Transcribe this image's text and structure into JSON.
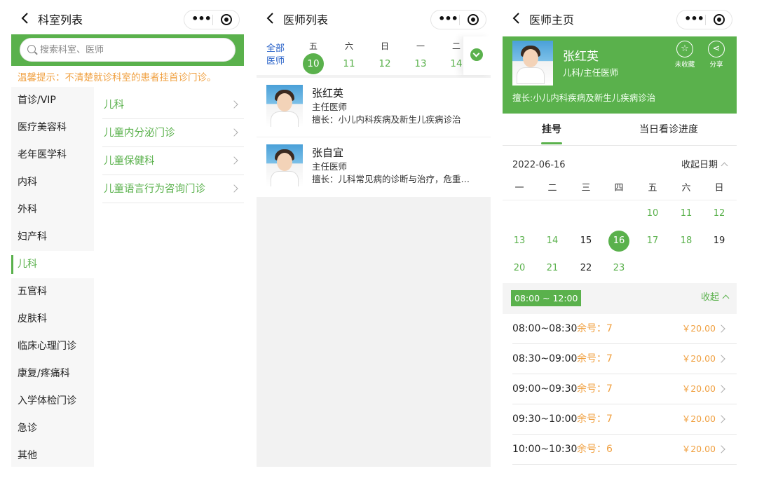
{
  "screen1": {
    "title": "科室列表",
    "search_placeholder": "搜索科室、医师",
    "tip": "温馨提示：不清楚就诊科室的患者挂首诊门诊。",
    "departments": [
      "首诊/VIP",
      "医疗美容科",
      "老年医学科",
      "内科",
      "外科",
      "妇产科",
      "儿科",
      "五官科",
      "皮肤科",
      "临床心理门诊",
      "康复/疼痛科",
      "入学体检门诊",
      "急诊",
      "其他"
    ],
    "active_department": "儿科",
    "sub_departments": [
      "儿科",
      "儿童内分泌门诊",
      "儿童保健科",
      "儿童语言行为咨询门诊"
    ]
  },
  "screen2": {
    "title": "医师列表",
    "all_label": "全部医师",
    "days": [
      {
        "weekday": "五",
        "day": "10",
        "selected": true
      },
      {
        "weekday": "六",
        "day": "11"
      },
      {
        "weekday": "日",
        "day": "12"
      },
      {
        "weekday": "一",
        "day": "13"
      },
      {
        "weekday": "二",
        "day": "14"
      }
    ],
    "doctors": [
      {
        "name": "张红英",
        "title": "主任医师",
        "skill": "擅长：小儿内科疾病及新生儿疾病诊治"
      },
      {
        "name": "张自宜",
        "title": "主任医师",
        "skill": "擅长：儿科常见病的诊断与治疗，危重…"
      }
    ]
  },
  "screen3": {
    "title": "医师主页",
    "doctor": {
      "name": "张红英",
      "dept": "儿科/主任医师",
      "skill": "擅长:小儿内科疾病及新生儿疾病诊治"
    },
    "favorite_label": "未收藏",
    "share_label": "分享",
    "tabs": [
      "挂号",
      "当日看诊进度"
    ],
    "date": "2022-06-16",
    "fold_date_label": "收起日期",
    "weekdays": [
      "一",
      "二",
      "三",
      "四",
      "五",
      "六",
      "日"
    ],
    "calendar": [
      {
        "d": "10",
        "state": "available"
      },
      {
        "d": "11",
        "state": "available"
      },
      {
        "d": "12",
        "state": "available"
      },
      {
        "d": "13",
        "state": "available"
      },
      {
        "d": "14",
        "state": "available"
      },
      {
        "d": "15",
        "state": "normal"
      },
      {
        "d": "16",
        "state": "selected"
      },
      {
        "d": "17",
        "state": "available"
      },
      {
        "d": "18",
        "state": "available"
      },
      {
        "d": "19",
        "state": "normal"
      },
      {
        "d": "20",
        "state": "available"
      },
      {
        "d": "21",
        "state": "available"
      },
      {
        "d": "22",
        "state": "normal"
      },
      {
        "d": "23",
        "state": "available"
      }
    ],
    "period": "08:00 ~ 12:00",
    "fold_label": "收起",
    "slots": [
      {
        "time": "08:00~08:30",
        "remain": "余号：7",
        "price": "￥20.00"
      },
      {
        "time": "08:30~09:00",
        "remain": "余号：7",
        "price": "￥20.00"
      },
      {
        "time": "09:00~09:30",
        "remain": "余号：7",
        "price": "￥20.00"
      },
      {
        "time": "09:30~10:00",
        "remain": "余号：7",
        "price": "￥20.00"
      },
      {
        "time": "10:00~10:30",
        "remain": "余号：6",
        "price": "￥20.00"
      }
    ]
  },
  "colors": {
    "accent": "#5ab14c",
    "warning": "#f0a040",
    "link": "#2a63c9"
  }
}
